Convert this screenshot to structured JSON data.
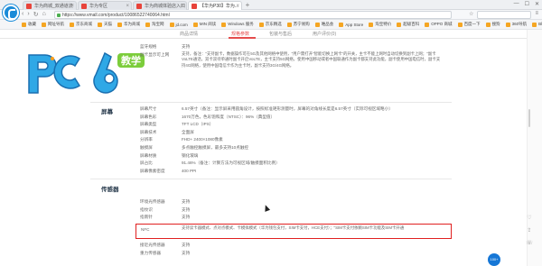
{
  "browser": {
    "tabs": [
      {
        "label": "华为商城_双通道流"
      },
      {
        "label": "华为专区"
      },
      {
        "label": "华为商城体验店入口"
      },
      {
        "label": "【华为P30】华为..."
      }
    ],
    "new_tab": "+",
    "url": "https://www.vmall.com/product/10086522740064.html",
    "window_controls": [
      "—",
      "☐",
      "✕"
    ]
  },
  "bookmarks": [
    "收藏",
    "网址导航",
    "京东商城",
    "天猫",
    "华为商城",
    "淘宝网",
    "jd.com",
    "MIN 阅读",
    "Windows 服务",
    "京东精选",
    "苏宁易购",
    "唯品会",
    "App Store",
    "淘宝特价",
    "超级百科",
    "OPPO 商城",
    "百度一下",
    "搜狗",
    "360导航",
    "Blu 商城",
    "网页游戏"
  ],
  "subnav": {
    "items": [
      "商品详情",
      "规格参数",
      "包装与售后",
      "用户评价(0)"
    ],
    "active": "规格参数"
  },
  "logo": {
    "text": "PC6",
    "badge": "教学"
  },
  "rows_top": [
    {
      "k": "蓝牙规格",
      "v": "支持"
    },
    {
      "k": "副卡显示可上网",
      "v": ""
    }
  ],
  "top_desc": "支持，备注：\"支持副卡，数据操作可在5G及其他网络中使用，\"用户需打开\"智能切换上网卡\"的开关，主卡不能上网时自动切换到副卡上网；\"副卡VoLTE通话，双卡双待单通时副卡开启VoLTE，主卡支持5G网络，使用中国移动或者中国联通作为副卡都支持此功能，副卡使用中国电信时，副卡支持4G网络，使用中国电信卡作为主卡时，副卡支持3G/4G网络。",
  "screen": {
    "title": "屏幕",
    "rows": [
      {
        "k": "屏幕尺寸",
        "v": "6.57英寸（备注：显示屏采用圆角设计，按照标准矩形测量时，屏幕的对角线长度是6.57英寸（实际可视区域略小）"
      },
      {
        "k": "屏幕色彩",
        "v": "1670万色，色彩饱和度（NTSC）：96%（典型值）"
      },
      {
        "k": "屏幕类型",
        "v": "TFT LCD（IPS）"
      },
      {
        "k": "屏幕技术",
        "v": "全面屏"
      },
      {
        "k": "分辨率",
        "v": "FHD+ 2400×1080像素"
      },
      {
        "k": "触摸屏",
        "v": "多点触控触摸屏，最多支持10点触控"
      },
      {
        "k": "屏幕材质",
        "v": "钢化玻璃"
      },
      {
        "k": "屏占比",
        "v": "91.46%（备注：计算方法为可视区域/触摸面积比例）"
      },
      {
        "k": "屏幕像素密度",
        "v": "400 PPI"
      }
    ]
  },
  "sensors": {
    "title": "传感器",
    "rows": [
      {
        "k": "环境光传感器",
        "v": "支持"
      },
      {
        "k": "指纹识",
        "v": "支持"
      },
      {
        "k": "指南针",
        "v": "支持"
      },
      {
        "k": "重力传感器",
        "v": "支持"
      }
    ],
    "nfc": {
      "k": "NFC",
      "v": "支持读卡器模式、点对点模式、卡模拟模式（华为钱包支付，SIM卡支付，HCE支付）；\"SIM卡支付依赖SIM卡功能及SIM卡开通"
    },
    "rows_after": [
      {
        "k": "接近光传感器",
        "v": "支持"
      },
      {
        "k": "重力传感器",
        "v": "支持"
      }
    ]
  },
  "float_button": "100+",
  "side_icons": [
    "收藏",
    "分享",
    "客服"
  ]
}
